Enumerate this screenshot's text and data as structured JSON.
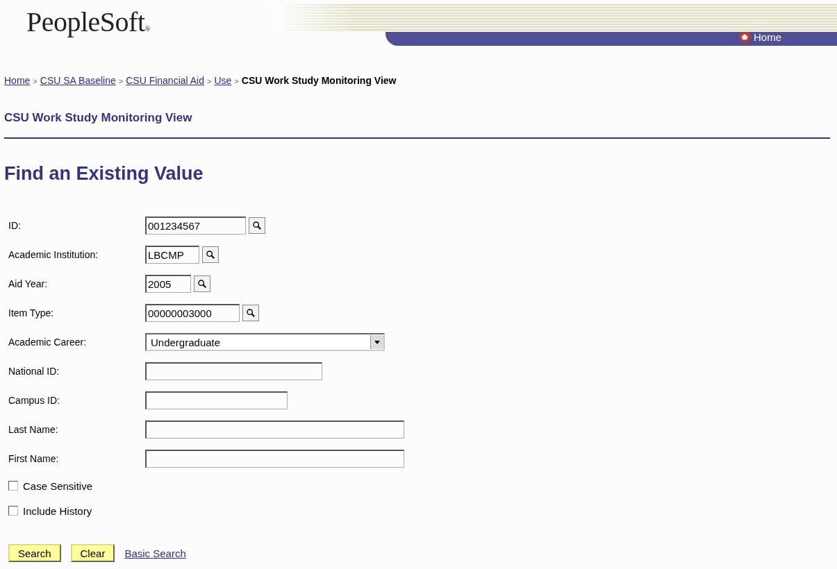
{
  "header": {
    "logo": "PeopleSoft",
    "logo_mark": "®",
    "home_link": "Home"
  },
  "breadcrumb": [
    {
      "label": "Home",
      "link": true
    },
    {
      "label": "CSU SA Baseline",
      "link": true
    },
    {
      "label": "CSU Financial Aid",
      "link": true
    },
    {
      "label": "Use",
      "link": true
    },
    {
      "label": "CSU Work Study Monitoring View",
      "link": false
    }
  ],
  "breadcrumb_separator": ">",
  "component_title": "CSU Work Study Monitoring View",
  "page_title": "Find an Existing Value",
  "fields": [
    {
      "label": "ID:",
      "kind": "lookup",
      "value": "001234567"
    },
    {
      "label": "Academic Institution:",
      "kind": "lookup",
      "value": "LBCMP"
    },
    {
      "label": "Aid Year:",
      "kind": "lookup",
      "value": "2005"
    },
    {
      "label": "Item Type:",
      "kind": "lookup",
      "value": "00000003000"
    },
    {
      "label": "Academic Career:",
      "kind": "select",
      "value": "Undergraduate"
    },
    {
      "label": "National ID:",
      "kind": "text"
    },
    {
      "label": "Campus ID:",
      "kind": "text"
    },
    {
      "label": "Last Name:",
      "kind": "text"
    },
    {
      "label": "First Name:",
      "kind": "text"
    }
  ],
  "options": [
    {
      "label": "Case Sensitive",
      "checked": false
    },
    {
      "label": "Include History",
      "checked": false
    }
  ],
  "buttons": [
    {
      "label": "Search"
    },
    {
      "label": "Clear"
    }
  ],
  "link": "Basic Search"
}
